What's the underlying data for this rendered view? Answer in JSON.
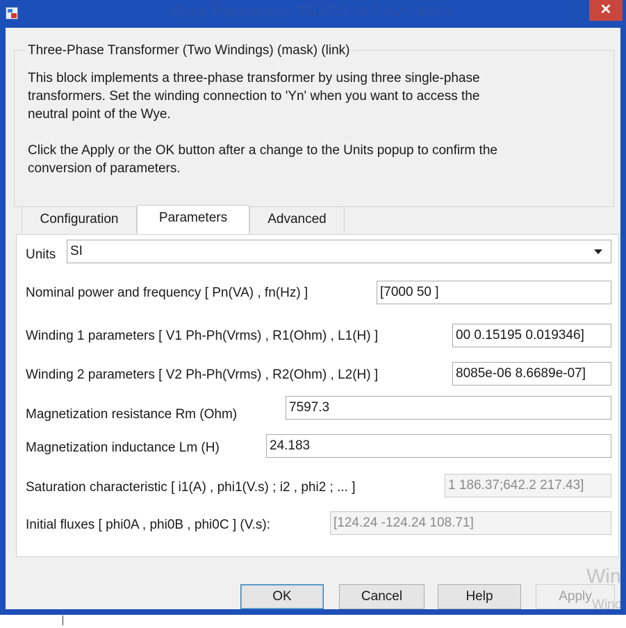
{
  "window": {
    "title": "Block Parameters: TRAFO 34.5 kV / 400 V",
    "close_glyph": "✕",
    "app_icon": "simulink-block-icon"
  },
  "mask": {
    "group_title": "Three-Phase Transformer (Two Windings) (mask) (link)",
    "description_lines_1": [
      "This block implements a three-phase transformer by using three single-phase",
      "transformers. Set the winding connection to 'Yn'  when you want to access the",
      "neutral point of the Wye."
    ],
    "description_lines_2": [
      "Click the Apply or the OK button after a change to the Units popup to confirm the",
      "conversion of parameters."
    ]
  },
  "tabs": {
    "configuration": "Configuration",
    "parameters": "Parameters",
    "advanced": "Advanced",
    "active": "Parameters"
  },
  "params": {
    "units_label": "Units",
    "units_value": "SI",
    "nominal_label": "Nominal power and frequency  [ Pn(VA) , fn(Hz) ]",
    "nominal_value": "[7000 50 ]",
    "w1_label": "Winding 1 parameters [ V1 Ph-Ph(Vrms) , R1(Ohm) , L1(H) ]",
    "w1_value": "00 0.15195 0.019346]",
    "w2_label": "Winding 2 parameters [ V2 Ph-Ph(Vrms) , R2(Ohm) , L2(H) ]",
    "w2_value": "8085e-06 8.6689e-07]",
    "rm_label": "Magnetization resistance  Rm (Ohm)",
    "rm_value": "7597.3",
    "lm_label": "Magnetization inductance  Lm (H)",
    "lm_value": "24.183",
    "sat_label": "Saturation characteristic [ i1(A) ,  phi1(V.s) ;  i2 , phi2 ; ... ]",
    "sat_value": "1 186.37;642.2 217.43]",
    "flux_label": "Initial fluxes [ phi0A , phi0B , phi0C ] (V.s):",
    "flux_value": "[124.24 -124.24 108.71]"
  },
  "buttons": {
    "ok": "OK",
    "cancel": "Cancel",
    "help": "Help",
    "apply": "Apply"
  },
  "watermark": {
    "big": "Win",
    "small": "Wind"
  }
}
